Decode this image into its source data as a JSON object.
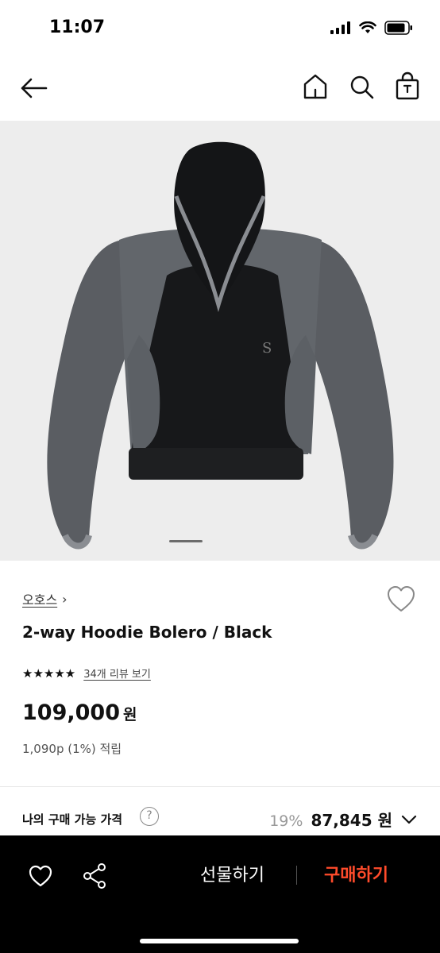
{
  "status_bar": {
    "time": "11:07",
    "icons": [
      "cellular-signal-icon",
      "wifi-icon",
      "battery-icon"
    ]
  },
  "nav": {
    "icons": [
      "back-arrow-icon",
      "home-icon",
      "search-icon",
      "shopping-bag-icon"
    ]
  },
  "gallery": {
    "active_index": 1,
    "image_description_icon": "product-photo"
  },
  "product": {
    "brand": "오호스",
    "brand_chevron": "›",
    "title": "2-way Hoodie Bolero / Black",
    "stars": "★★★★★",
    "review_link": "34개 리뷰 보기",
    "price": "109,000",
    "price_unit": "원",
    "points": "1,090p (1%) 적립"
  },
  "buy_price": {
    "label": "나의 구매 가능 가격",
    "help": "?",
    "discount": "19%",
    "price": "87,845 원"
  },
  "bottom_bar": {
    "gift_label": "선물하기",
    "buy_label": "구매하기"
  },
  "colors": {
    "accent": "#ff4b2b",
    "bar_bg": "#000000",
    "hero_bg": "#ededed"
  }
}
